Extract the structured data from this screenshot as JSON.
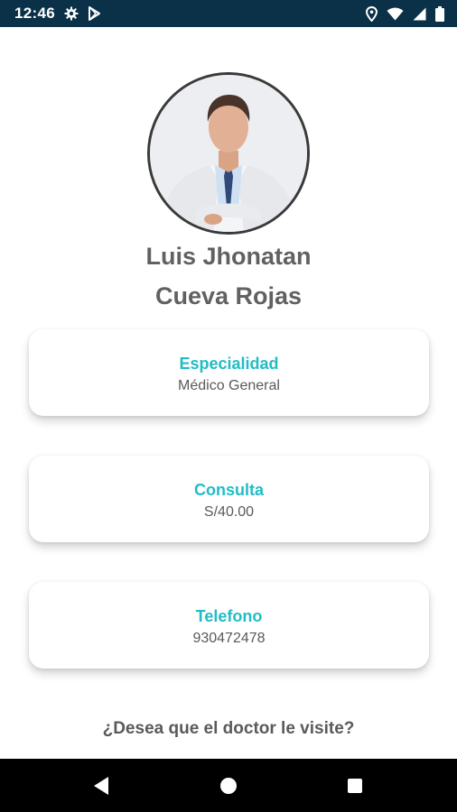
{
  "status_bar": {
    "time": "12:46",
    "left_icons": [
      "gear-icon",
      "play-store-icon"
    ],
    "right_icons": [
      "location-icon",
      "wifi-icon",
      "signal-icon",
      "battery-icon"
    ]
  },
  "profile": {
    "photo": "doctor-photo",
    "name_line1": "Luis Jhonatan",
    "name_line2": "Cueva Rojas"
  },
  "cards": [
    {
      "title": "Especialidad",
      "value": "Médico General"
    },
    {
      "title": "Consulta",
      "value": "S/40.00"
    },
    {
      "title": "Telefono",
      "value": "930472478"
    }
  ],
  "visit_question": "¿Desea que el doctor le visite?",
  "nav_bar": {
    "icons": [
      "back-icon",
      "home-icon",
      "recents-icon"
    ]
  },
  "colors": {
    "status_bar": "#0b3148",
    "accent": "#22bcc6",
    "text": "#616161"
  }
}
